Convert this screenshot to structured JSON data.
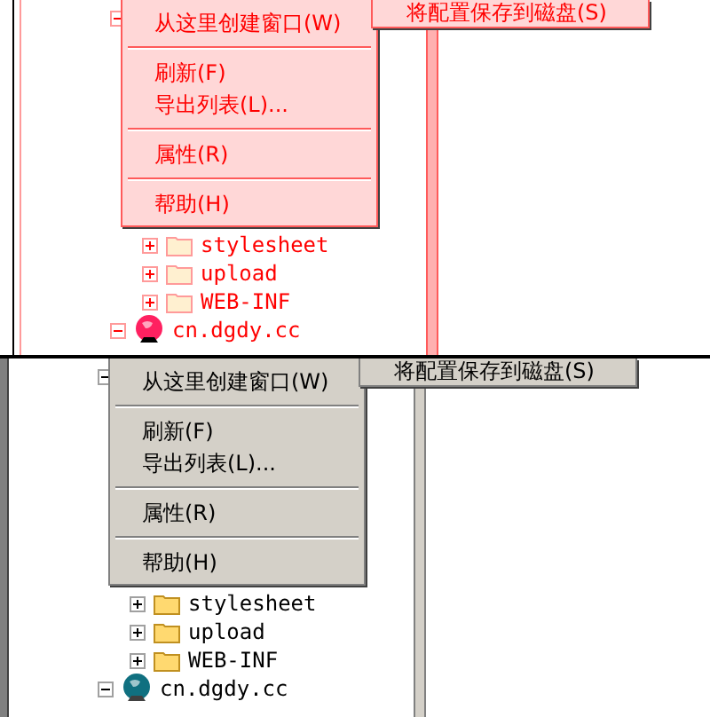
{
  "panels": [
    {
      "kind": "highlighted",
      "menu": {
        "groups": [
          [
            "从这里创建窗口(W)"
          ],
          [
            "刷新(F)",
            "导出列表(L)..."
          ],
          [
            "属性(R)"
          ],
          [
            "帮助(H)"
          ]
        ]
      },
      "submenu": {
        "label": "将配置保存到磁盘(S)"
      },
      "tree": [
        {
          "expanded": true,
          "children": [
            {
              "label": "stylesheet",
              "kind": "folder",
              "expanded": false
            },
            {
              "label": "upload",
              "kind": "folder",
              "expanded": false
            },
            {
              "label": "WEB-INF",
              "kind": "folder",
              "expanded": false
            }
          ]
        },
        {
          "label": "cn.dgdy.cc",
          "kind": "site",
          "expanded": true
        }
      ]
    },
    {
      "kind": "normal",
      "menu": {
        "groups": [
          [
            "从这里创建窗口(W)"
          ],
          [
            "刷新(F)",
            "导出列表(L)..."
          ],
          [
            "属性(R)"
          ],
          [
            "帮助(H)"
          ]
        ]
      },
      "submenu": {
        "label": "将配置保存到磁盘(S)"
      },
      "tree": [
        {
          "expanded": true,
          "children": [
            {
              "label": "stylesheet",
              "kind": "folder",
              "expanded": false
            },
            {
              "label": "upload",
              "kind": "folder",
              "expanded": false
            },
            {
              "label": "WEB-INF",
              "kind": "folder",
              "expanded": false
            }
          ]
        },
        {
          "label": "cn.dgdy.cc",
          "kind": "site",
          "expanded": true
        }
      ]
    }
  ]
}
